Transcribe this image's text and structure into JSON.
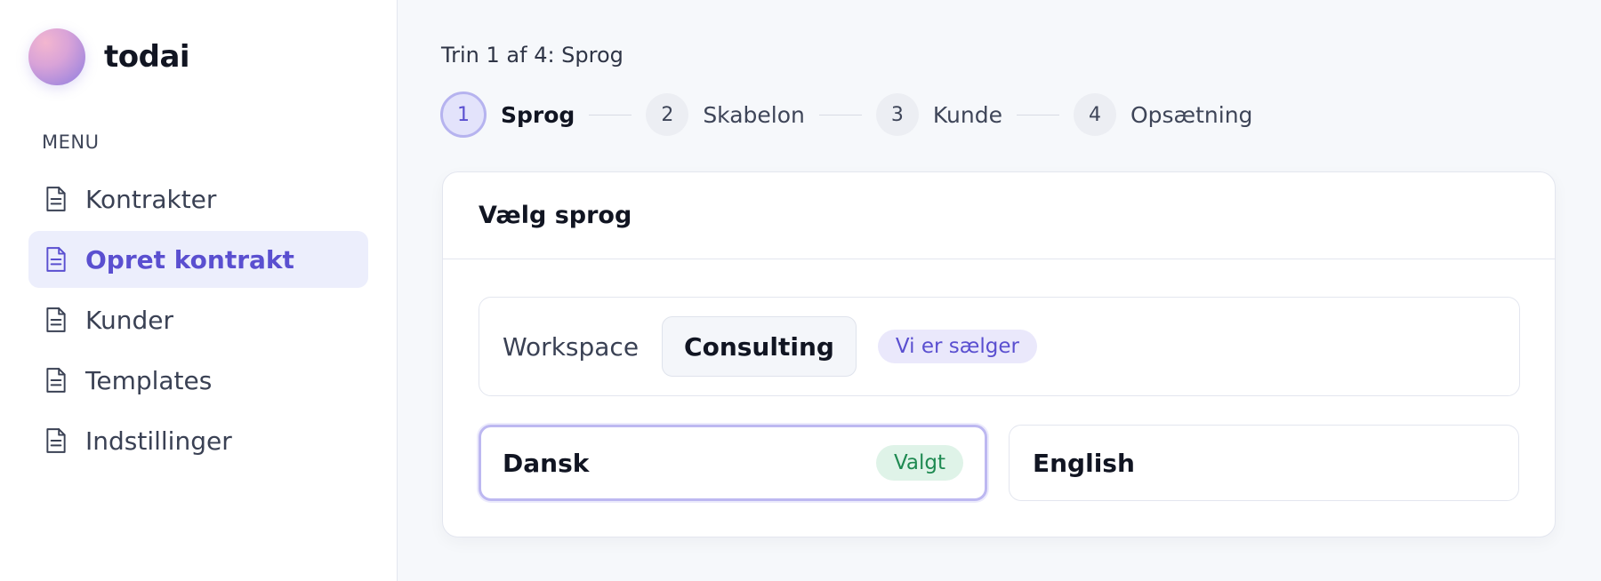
{
  "brand": {
    "name": "todai"
  },
  "sidebar": {
    "heading": "MENU",
    "items": [
      {
        "label": "Kontrakter",
        "icon": "document-icon",
        "active": false
      },
      {
        "label": "Opret kontrakt",
        "icon": "document-icon",
        "active": true
      },
      {
        "label": "Kunder",
        "icon": "document-icon",
        "active": false
      },
      {
        "label": "Templates",
        "icon": "document-icon",
        "active": false
      },
      {
        "label": "Indstillinger",
        "icon": "document-icon",
        "active": false
      }
    ]
  },
  "wizard": {
    "caption": "Trin 1 af 4: Sprog",
    "steps": [
      {
        "number": "1",
        "label": "Sprog",
        "active": true
      },
      {
        "number": "2",
        "label": "Skabelon",
        "active": false
      },
      {
        "number": "3",
        "label": "Kunde",
        "active": false
      },
      {
        "number": "4",
        "label": "Opsætning",
        "active": false
      }
    ]
  },
  "card": {
    "title": "Vælg sprog",
    "workspace": {
      "label": "Workspace",
      "value": "Consulting",
      "badge": "Vi er sælger"
    },
    "languages": [
      {
        "label": "Dansk",
        "badge": "Valgt",
        "selected": true
      },
      {
        "label": "English",
        "badge": "",
        "selected": false
      }
    ]
  },
  "colors": {
    "accent": "#5a4fd0",
    "active_bg": "#eceefc",
    "success": "#1f8a52",
    "success_bg": "#dff3e8"
  }
}
